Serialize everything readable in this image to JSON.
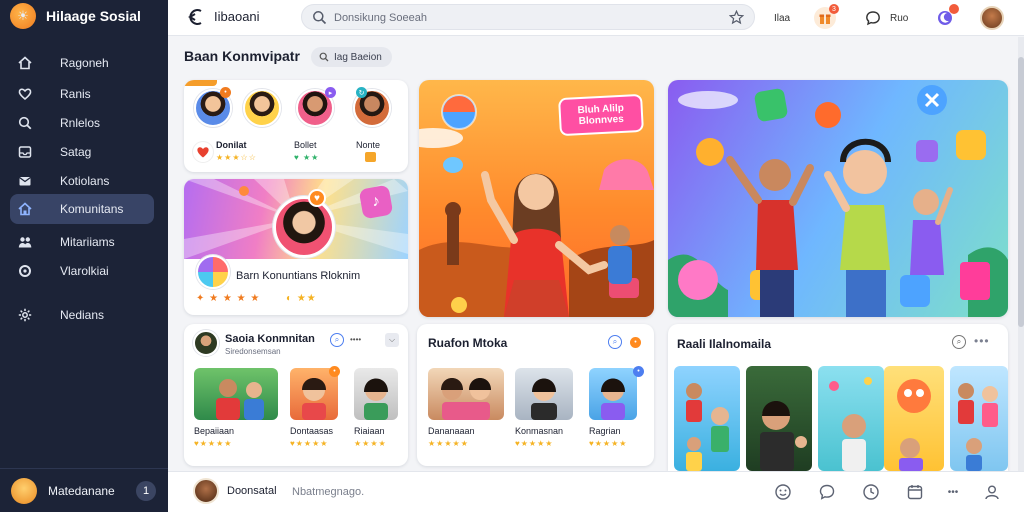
{
  "app": {
    "title": "Hilaage Sosial",
    "logo_icon": "sun-logo-icon"
  },
  "sidebar": {
    "items": [
      {
        "label": "Ragoneh",
        "icon": "home-icon"
      },
      {
        "label": "Ranis",
        "icon": "heart-icon"
      },
      {
        "label": "Rnlelos",
        "icon": "search-icon"
      },
      {
        "label": "Satag",
        "icon": "inbox-icon"
      },
      {
        "label": "Kotiolans",
        "icon": "mail-icon"
      },
      {
        "label": "Komunitans",
        "icon": "community-icon",
        "active": true
      },
      {
        "label": "Mitariiams",
        "icon": "people-icon"
      },
      {
        "label": "Vlarolkiai",
        "icon": "circle-icon"
      },
      {
        "label": "Nedians",
        "icon": "settings-icon"
      }
    ],
    "footer": {
      "name": "Matedanane",
      "badge": "1"
    }
  },
  "topbar": {
    "title": "Iibaoani",
    "search_placeholder": "Donsikung Soeeah",
    "text1": "Ilaa",
    "text2": "Ruo",
    "notif_count": "3"
  },
  "main": {
    "section_title": "Baan Konmvipatr",
    "chip_label": "Iag Baeion",
    "top_left_card": {
      "names": [
        "Donilat",
        "Bollet",
        "Nonte"
      ],
      "row2": "Barn Konuntians Rloknim"
    },
    "hero_banner_text": [
      "Bluh Alilp",
      "Blonnves"
    ],
    "group_card": {
      "title": "Saoia Konmnitan",
      "subtitle": "Siredonsemsan",
      "names": [
        "Bepaiiaan",
        "Dontaasas",
        "Riaiaan"
      ]
    },
    "popular_card": {
      "title": "Ruafon Mtoka",
      "names": [
        "Dananaaan",
        "Konmasnan",
        "Ragrian"
      ]
    },
    "recommend_card": {
      "title": "Raali Ilalnomaila"
    }
  },
  "bottombar": {
    "name": "Doonsatal",
    "placeholder": "Nbatmegnago."
  },
  "colors": {
    "sidebar_bg": "#1c2337",
    "sidebar_active": "#384466",
    "accent_orange": "#f07b1f",
    "accent_purple": "#8a5cf0",
    "star_gold": "#f5b324"
  }
}
